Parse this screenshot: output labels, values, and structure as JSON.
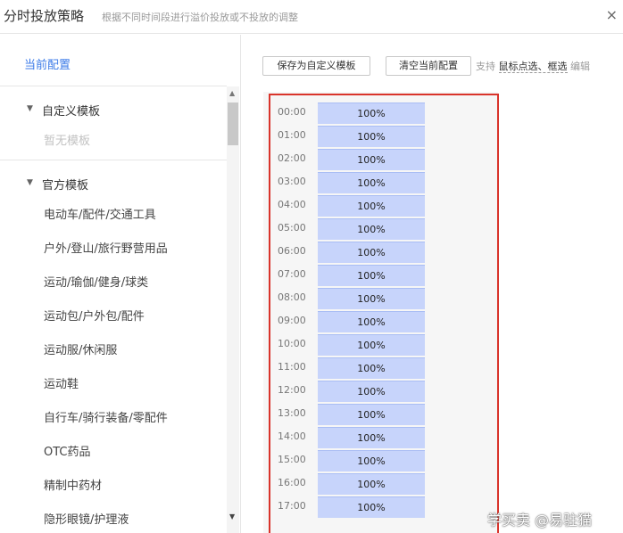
{
  "dialog": {
    "title": "分时投放策略",
    "subtitle": "根据不同时间段进行溢价投放或不投放的调整",
    "close_icon": "×"
  },
  "sidebar": {
    "current_config": "当前配置",
    "custom_group": {
      "label": "自定义模板",
      "empty_text": "暂无模板"
    },
    "official_group": {
      "label": "官方模板",
      "items": [
        "电动车/配件/交通工具",
        "户外/登山/旅行野营用品",
        "运动/瑜伽/健身/球类",
        "运动包/户外包/配件",
        "运动服/休闲服",
        "运动鞋",
        "自行车/骑行装备/零配件",
        "OTC药品",
        "精制中药材",
        "隐形眼镜/护理液"
      ]
    }
  },
  "toolbar": {
    "save_label": "保存为自定义模板",
    "clear_label": "清空当前配置",
    "hint_prefix": "支持",
    "hint_bold": "鼠标点选、框选",
    "hint_suffix": "编辑"
  },
  "schedule": {
    "rows": [
      {
        "time": "00:00",
        "value": "100%"
      },
      {
        "time": "01:00",
        "value": "100%"
      },
      {
        "time": "02:00",
        "value": "100%"
      },
      {
        "time": "03:00",
        "value": "100%"
      },
      {
        "time": "04:00",
        "value": "100%"
      },
      {
        "time": "05:00",
        "value": "100%"
      },
      {
        "time": "06:00",
        "value": "100%"
      },
      {
        "time": "07:00",
        "value": "100%"
      },
      {
        "time": "08:00",
        "value": "100%"
      },
      {
        "time": "09:00",
        "value": "100%"
      },
      {
        "time": "10:00",
        "value": "100%"
      },
      {
        "time": "11:00",
        "value": "100%"
      },
      {
        "time": "12:00",
        "value": "100%"
      },
      {
        "time": "13:00",
        "value": "100%"
      },
      {
        "time": "14:00",
        "value": "100%"
      },
      {
        "time": "15:00",
        "value": "100%"
      },
      {
        "time": "16:00",
        "value": "100%"
      },
      {
        "time": "17:00",
        "value": "100%"
      }
    ]
  },
  "watermark": "学买卖 @易驻猫",
  "colors": {
    "accent": "#3c7be8",
    "cell": "#c7d4fb",
    "highlight_border": "#d9342b"
  }
}
